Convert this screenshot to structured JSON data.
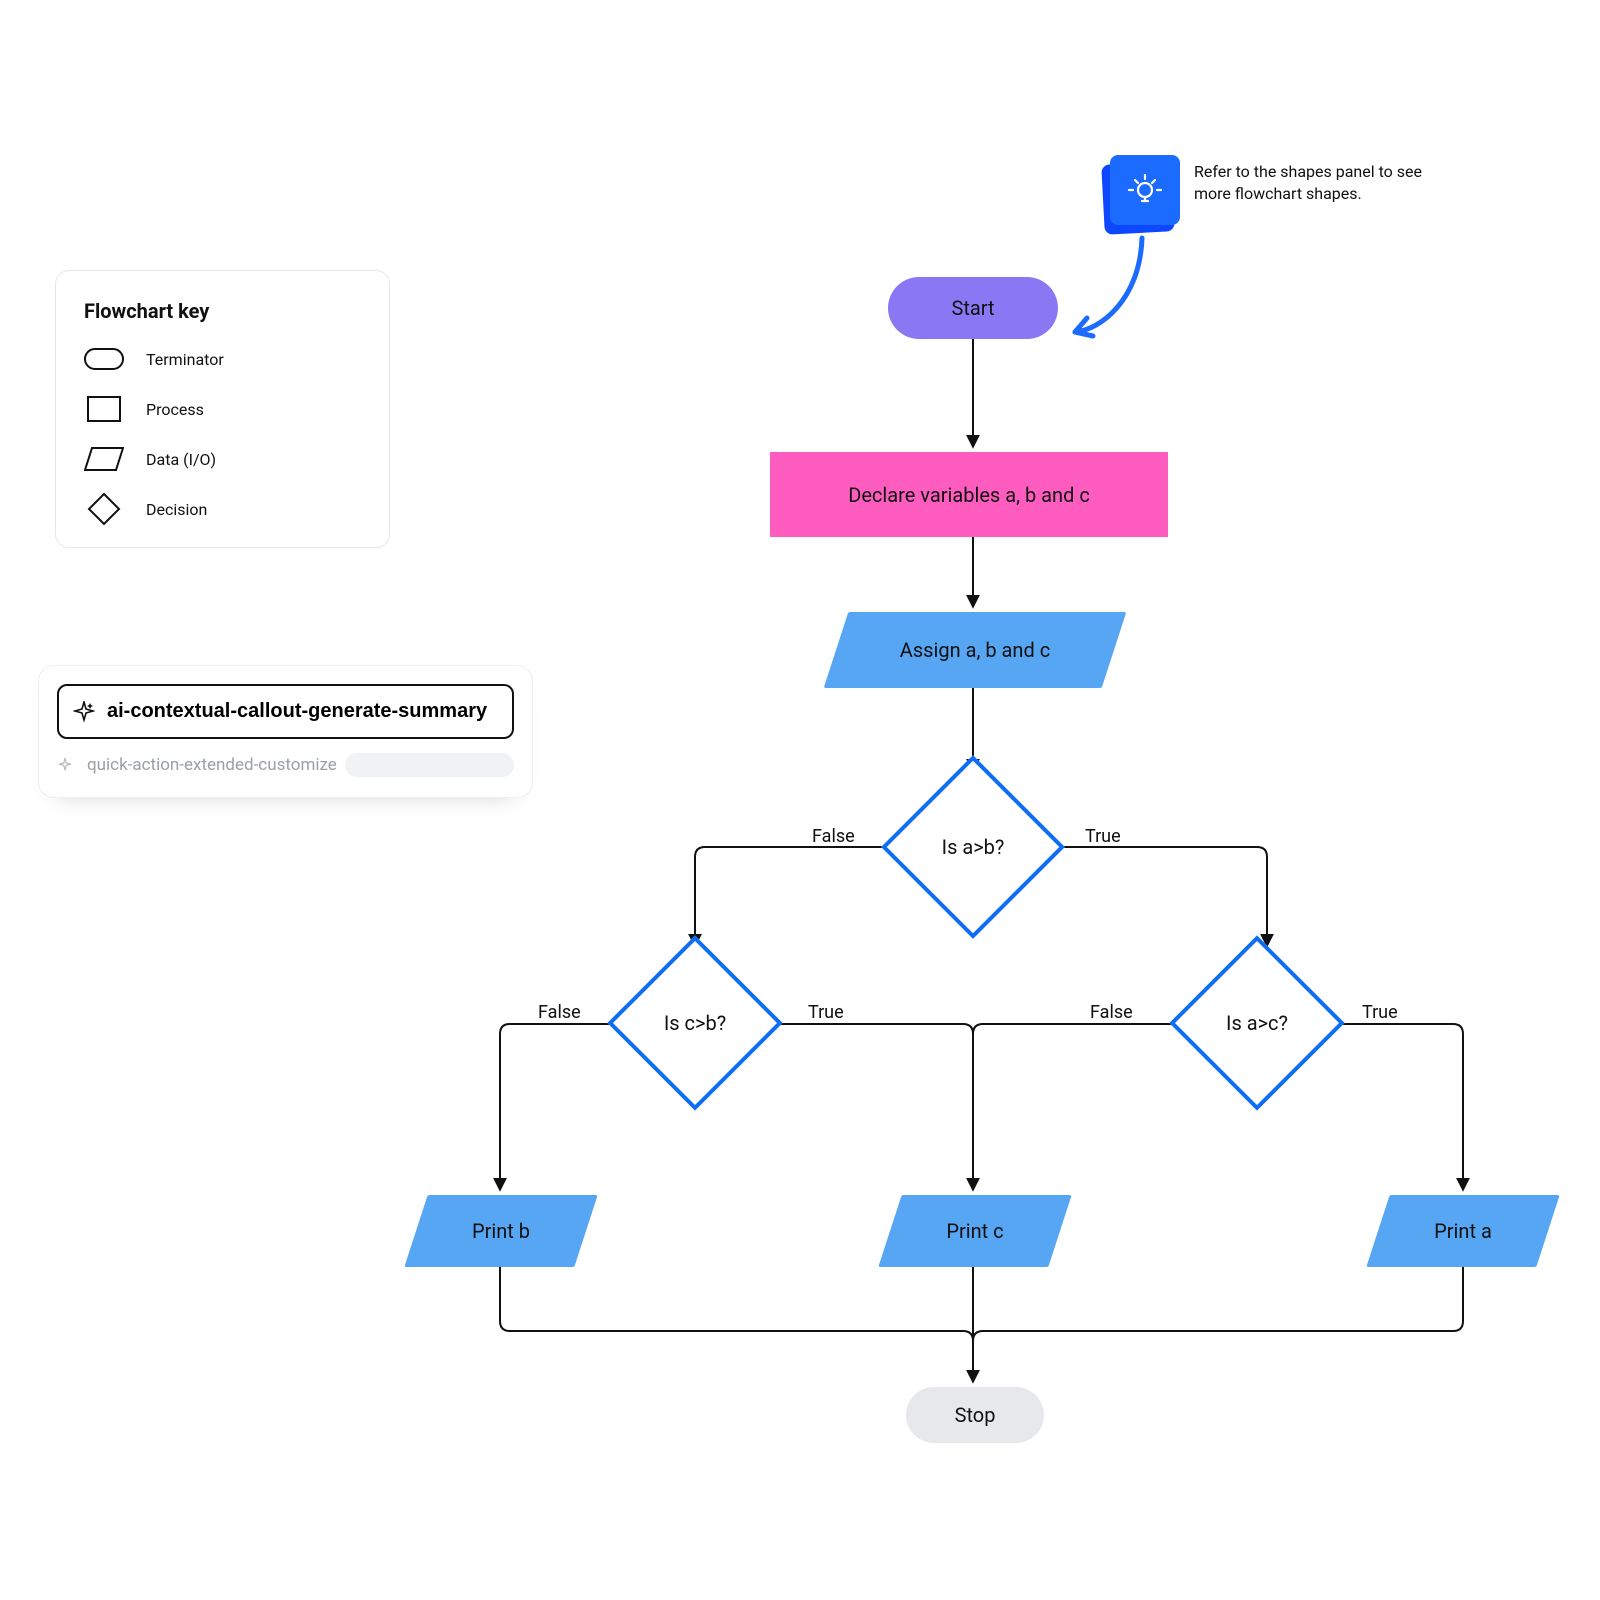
{
  "key": {
    "title": "Flowchart key",
    "items": [
      {
        "label": "Terminator"
      },
      {
        "label": "Process"
      },
      {
        "label": "Data (I/O)"
      },
      {
        "label": "Decision"
      }
    ]
  },
  "ai": {
    "button_label": "ai-contextual-callout-generate-summary",
    "subline": "quick-action-extended-customize"
  },
  "hint": {
    "text_line1": "Refer to the shapes panel to see",
    "text_line2": "more flowchart shapes."
  },
  "flow": {
    "start": "Start",
    "declare": "Declare variables a, b and c",
    "assign": "Assign a, b and c",
    "dec_ab": "Is a>b?",
    "dec_cb": "Is c>b?",
    "dec_ac": "Is a>c?",
    "print_b": "Print b",
    "print_c": "Print c",
    "print_a": "Print a",
    "stop": "Stop"
  },
  "edge_labels": {
    "ab_true": "True",
    "ab_false": "False",
    "cb_true": "True",
    "cb_false": "False",
    "ac_true": "True",
    "ac_false": "False"
  }
}
